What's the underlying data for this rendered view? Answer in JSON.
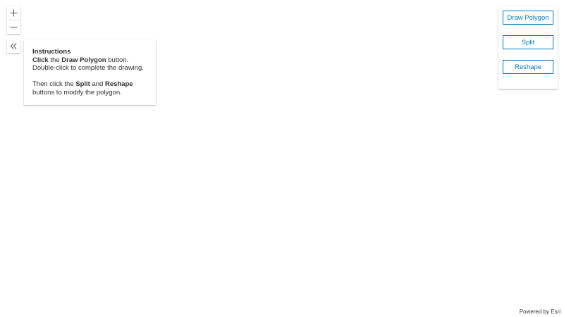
{
  "controls": {
    "zoom_in_icon": "plus-icon",
    "zoom_out_icon": "minus-icon",
    "collapse_icon": "double-chevron-left-icon"
  },
  "instructions": {
    "title": "Instructions",
    "line1_bold1": "Click",
    "line1_text1": " the ",
    "line1_bold2": "Draw Polygon",
    "line1_text2": " button. Double-click to complete the drawing.",
    "line2_text1": "Then click the ",
    "line2_bold1": "Split",
    "line2_text2": " and ",
    "line2_bold2": "Reshape",
    "line2_text3": " buttons to modify the polygon."
  },
  "tools": {
    "draw_polygon_label": "Draw Polygon",
    "split_label": "Split",
    "reshape_label": "Reshape"
  },
  "attribution": {
    "text": "Powered by Esri"
  },
  "colors": {
    "accent": "#0079c1",
    "text": "#323232",
    "background": "#ffffff"
  }
}
